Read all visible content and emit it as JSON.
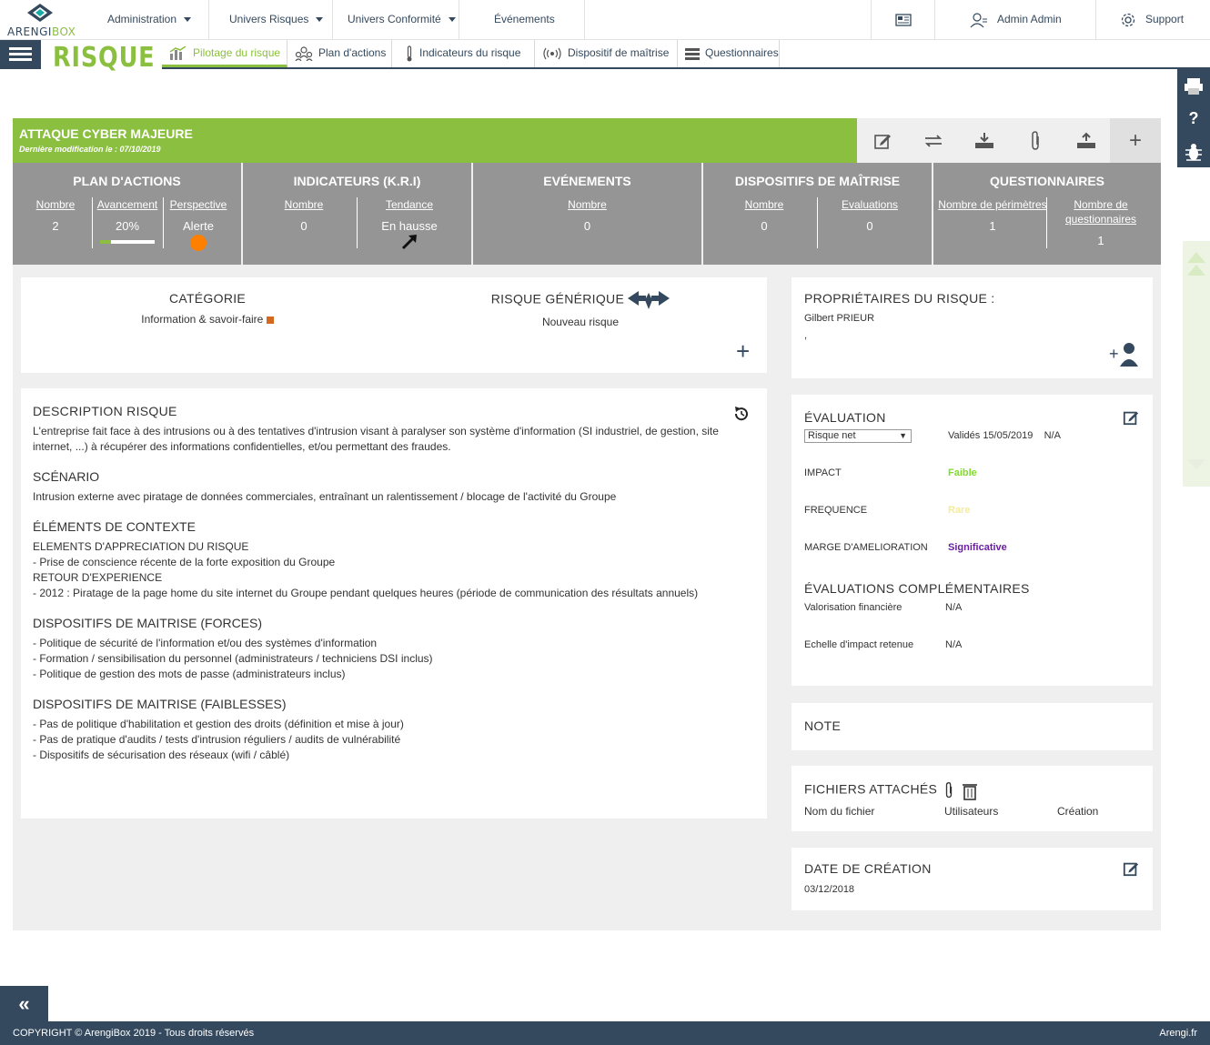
{
  "brand": {
    "name_part1": "ARENGI",
    "name_part2": "BOX"
  },
  "topnav": {
    "administration": "Administration",
    "univers_risques": "Univers Risques",
    "univers_conformite": "Univers Conformité",
    "evenements": "Événements",
    "user": "Admin Admin",
    "support": "Support"
  },
  "page_title": "RISQUE",
  "tabs": [
    {
      "label": "Pilotage du risque",
      "icon": "chart-icon",
      "active": true
    },
    {
      "label": "Plan d'actions",
      "icon": "people-icon",
      "active": false
    },
    {
      "label": "Indicateurs du risque",
      "icon": "thermometer-icon",
      "active": false
    },
    {
      "label": "Dispositif de maîtrise",
      "icon": "broadcast-icon",
      "active": false
    },
    {
      "label": "Questionnaires",
      "icon": "list-icon",
      "active": false
    }
  ],
  "sidetools": {
    "help": "?"
  },
  "risk": {
    "title": "ATTAQUE CYBER MAJEURE",
    "last_modified": "Dernière modification le : 07/10/2019"
  },
  "stats": {
    "plan": {
      "title": "PLAN D'ACTIONS",
      "nombre_label": "Nombre",
      "nombre": "2",
      "avancement_label": "Avancement",
      "avancement": "20%",
      "avancement_fraction": 0.2,
      "perspective_label": "Perspective",
      "perspective": "Alerte",
      "perspective_color": "#ff7f00"
    },
    "kri": {
      "title": "INDICATEURS (K.R.I)",
      "nombre_label": "Nombre",
      "nombre": "0",
      "tendance_label": "Tendance",
      "tendance": "En hausse"
    },
    "evenements": {
      "title": "EVÉNEMENTS",
      "nombre_label": "Nombre",
      "nombre": "0"
    },
    "dispositifs": {
      "title": "DISPOSITIFS DE MAÎTRISE",
      "nombre_label": "Nombre",
      "nombre": "0",
      "evaluations_label": "Evaluations",
      "evaluations": "0"
    },
    "questionnaires": {
      "title": "QUESTIONNAIRES",
      "perimetres_label": "Nombre de périmètres",
      "perimetres": "1",
      "questionnaires_label": "Nombre de questionnaires",
      "questionnaires": "1"
    }
  },
  "categorie": {
    "title": "CATÉGORIE",
    "value": "Information & savoir-faire",
    "color": "#d2691e"
  },
  "generique": {
    "title": "RISQUE GÉNÉRIQUE",
    "value": "Nouveau risque"
  },
  "proprietaires": {
    "title": "PROPRIÉTAIRES DU RISQUE :",
    "name": "Gilbert PRIEUR",
    "extra": ","
  },
  "description": {
    "title": "DESCRIPTION RISQUE",
    "text": "L'entreprise fait face à des intrusions ou à des tentatives d'intrusion visant à paralyser son système d'information (SI industriel, de gestion, site internet, ...) à récupérer des informations confidentielles, et/ou permettant des fraudes.",
    "scenario_title": "SCÉNARIO",
    "scenario": "Intrusion externe avec piratage de données commerciales, entraînant un ralentissement / blocage de l'activité du Groupe",
    "contexte_title": "ÉLÉMENTS DE CONTEXTE",
    "contexte_lines": [
      "ELEMENTS D'APPRECIATION DU RISQUE",
      "- Prise de conscience récente de la forte exposition du Groupe",
      "RETOUR D'EXPERIENCE",
      "- 2012 : Piratage de la page home du site internet du Groupe pendant quelques heures (période de communication des résultats annuels)"
    ],
    "forces_title": "DISPOSITIFS DE MAITRISE (FORCES)",
    "forces_lines": [
      "- Politique de sécurité de l'information et/ou des systèmes d'information",
      "- Formation / sensibilisation du personnel (administrateurs / techniciens DSI inclus)",
      "- Politique de gestion des mots de passe (administrateurs inclus)"
    ],
    "faiblesses_title": "DISPOSITIFS DE MAITRISE (FAIBLESSES)",
    "faiblesses_lines": [
      "- Pas de politique d'habilitation et gestion des droits (définition et mise à jour)",
      "- Pas de pratique d'audits / tests d'intrusion réguliers / audits de vulnérabilité",
      "- Dispositifs de sécurisation des réseaux (wifi / câblé)"
    ]
  },
  "evaluation": {
    "title": "ÉVALUATION",
    "select_value": "Risque net",
    "validated": "Validés 15/05/2019",
    "validated_na": "N/A",
    "impact_label": "IMPACT",
    "impact": "Faible",
    "impact_color": "#7fdc2c",
    "frequence_label": "FREQUENCE",
    "frequence": "Rare",
    "frequence_color": "#f3ec9a",
    "marge_label": "MARGE D'AMELIORATION",
    "marge": "Significative",
    "marge_color": "#6b1fa0",
    "compl_title": "ÉVALUATIONS COMPLÉMENTAIRES",
    "valo_label": "Valorisation financière",
    "valo": "N/A",
    "echelle_label": "Echelle d'impact retenue",
    "echelle": "N/A"
  },
  "note": {
    "title": "NOTE"
  },
  "fichiers": {
    "title": "FICHIERS ATTACHÉS",
    "col1": "Nom du fichier",
    "col2": "Utilisateurs",
    "col3": "Création"
  },
  "creation": {
    "title": "DATE DE CRÉATION",
    "date": "03/12/2018"
  },
  "footer": {
    "copyright": "COPYRIGHT © ArengiBox 2019 - Tous droits réservés",
    "link": "Arengi.fr"
  }
}
